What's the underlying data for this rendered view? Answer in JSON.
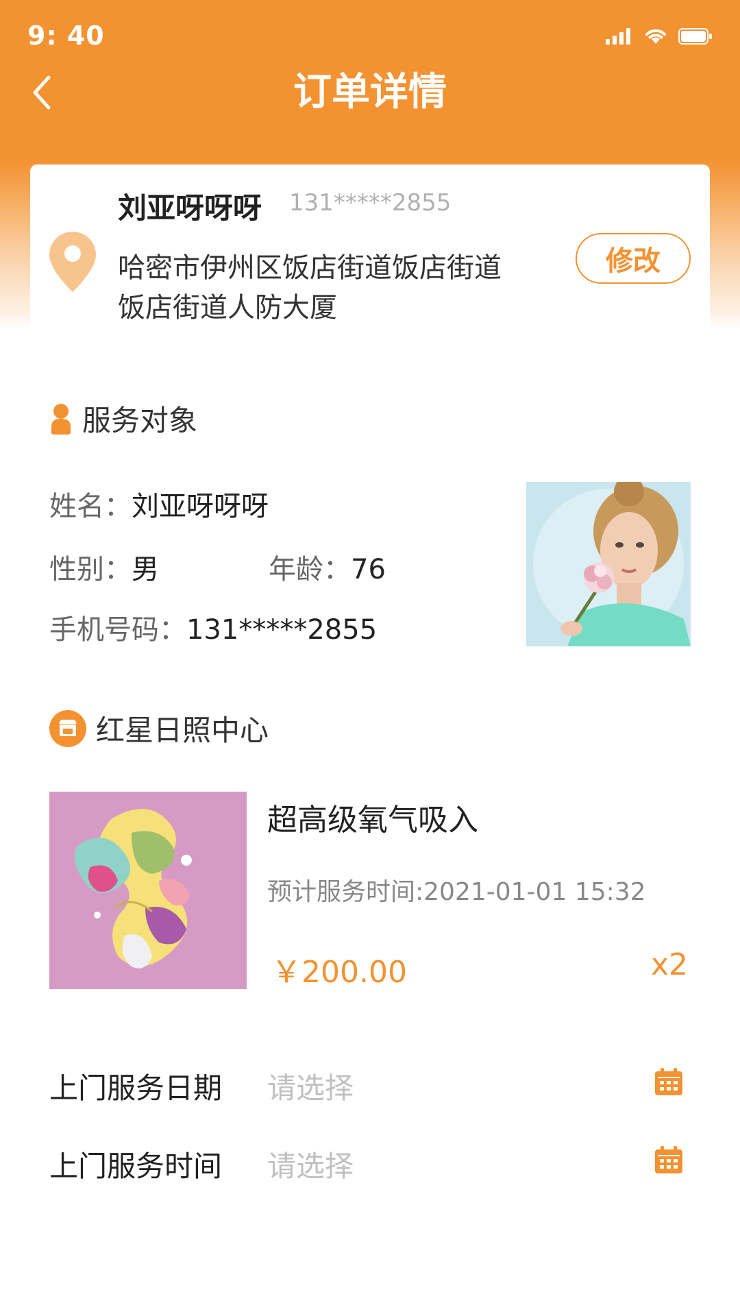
{
  "status_bar": {
    "time": "9: 40",
    "icons": [
      "signal-icon",
      "wifi-icon",
      "battery-icon"
    ]
  },
  "nav": {
    "title": "订单详情",
    "back_icon": "chevron-left-icon"
  },
  "address": {
    "name": "刘亚呀呀呀",
    "phone": "131*****2855",
    "lines": [
      "哈密市伊州区饭店街道饭店街道",
      "饭店街道人防大厦"
    ],
    "edit_label": "修改",
    "pin_icon": "location-pin-icon"
  },
  "service_target": {
    "title": "服务对象",
    "icon": "person-icon",
    "name_label": "姓名：",
    "name_value": "刘亚呀呀呀",
    "gender_label": "性别：",
    "gender_value": "男",
    "age_label": "年龄：",
    "age_value": "76",
    "phone_label": "手机号码：",
    "phone_value": "131*****2855"
  },
  "store": {
    "name": "红星日照中心",
    "icon": "store-icon"
  },
  "product": {
    "name": "超高级氧气吸入",
    "expected_time": "预计服务时间:2021-01-01 15:32",
    "price": "￥200.00",
    "quantity": "x2"
  },
  "form": {
    "date_label": "上门服务日期",
    "date_placeholder": "请选择",
    "time_label": "上门服务时间",
    "time_placeholder": "请选择",
    "calendar_icon": "calendar-icon"
  },
  "colors": {
    "accent": "#f39231",
    "pin": "#f8c48e",
    "text_primary": "#222222",
    "text_secondary": "#666666",
    "placeholder": "#c0c0c0"
  }
}
